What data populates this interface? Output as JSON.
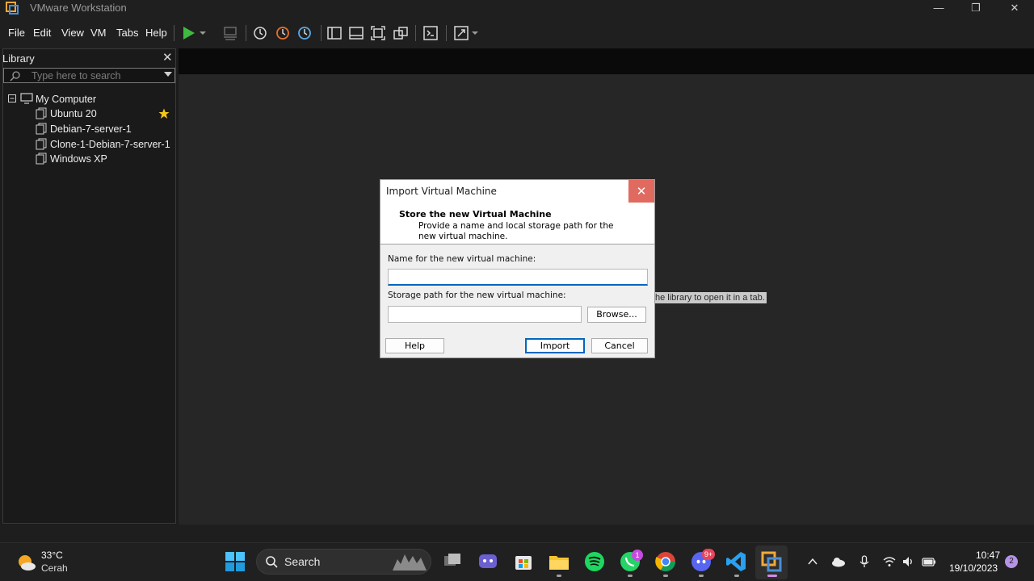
{
  "window": {
    "title": "VMware Workstation"
  },
  "menu": [
    "File",
    "Edit",
    "View",
    "VM",
    "Tabs",
    "Help"
  ],
  "library": {
    "title": "Library",
    "search_placeholder": "Type here to search",
    "root": "My Computer",
    "items": [
      {
        "label": "Ubuntu 20",
        "favorite": true
      },
      {
        "label": "Debian-7-server-1",
        "favorite": false
      },
      {
        "label": "Clone-1-Debian-7-server-1",
        "favorite": false
      },
      {
        "label": "Windows XP",
        "favorite": false
      }
    ]
  },
  "main": {
    "hint": "he library to open it in a tab."
  },
  "dialog": {
    "title": "Import Virtual Machine",
    "heading": "Store the new Virtual Machine",
    "description": "Provide a name and local storage path for the new virtual machine.",
    "name_label": "Name for the new virtual machine:",
    "name_value": "",
    "path_label": "Storage path for the new virtual machine:",
    "path_value": "",
    "browse_label": "Browse...",
    "help_label": "Help",
    "import_label": "Import",
    "cancel_label": "Cancel"
  },
  "taskbar": {
    "weather": {
      "temp": "33°C",
      "condition": "Cerah"
    },
    "search_label": "Search",
    "whatsapp_badge": "1",
    "discord_badge": "9+",
    "time": "10:47",
    "date": "19/10/2023",
    "notifications": "2"
  },
  "colors": {
    "accent_blue": "#0067c0",
    "play_green": "#3fb93f",
    "close_red": "#e06a60",
    "badge_purple": "#c74ae0"
  }
}
